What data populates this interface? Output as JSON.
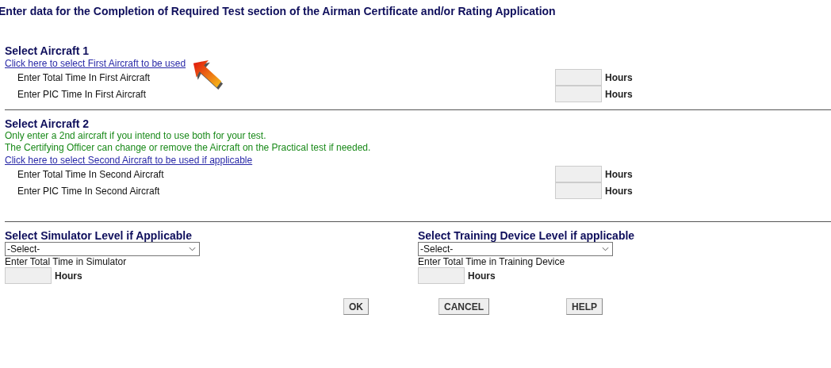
{
  "title": "Enter data for the Completion of Required Test section of the Airman Certificate and/or Rating Application",
  "aircraft_sections": [
    {
      "heading": "Select Aircraft 1",
      "link": "Click here to select First Aircraft to be used",
      "time_fields": [
        {
          "label": "Enter Total Time In First Aircraft",
          "unit": "Hours"
        },
        {
          "label": "Enter PIC Time In First Aircraft",
          "unit": "Hours"
        }
      ]
    },
    {
      "heading": "Select Aircraft 2",
      "notes": [
        "Only enter a 2nd aircraft if you intend to use both for your test.",
        "The Certifying Officer can change or remove the Aircraft on the Practical test if needed."
      ],
      "link": "Click here to select Second Aircraft to be used if applicable ",
      "time_fields": [
        {
          "label": "Enter Total Time In Second Aircraft",
          "unit": "Hours"
        },
        {
          "label": "Enter PIC Time In Second Aircraft",
          "unit": "Hours"
        }
      ]
    }
  ],
  "level_sections": [
    {
      "heading": "Select Simulator Level if Applicable",
      "select": {
        "value": "-Select-"
      },
      "time_label": "Enter Total Time in Simulator",
      "unit": "Hours"
    },
    {
      "heading": "Select Training Device Level if applicable",
      "select": {
        "value": "-Select-"
      },
      "time_label": "Enter Total Time in Training Device",
      "unit": "Hours"
    }
  ],
  "buttons": [
    "OK",
    "CANCEL",
    "HELP"
  ]
}
